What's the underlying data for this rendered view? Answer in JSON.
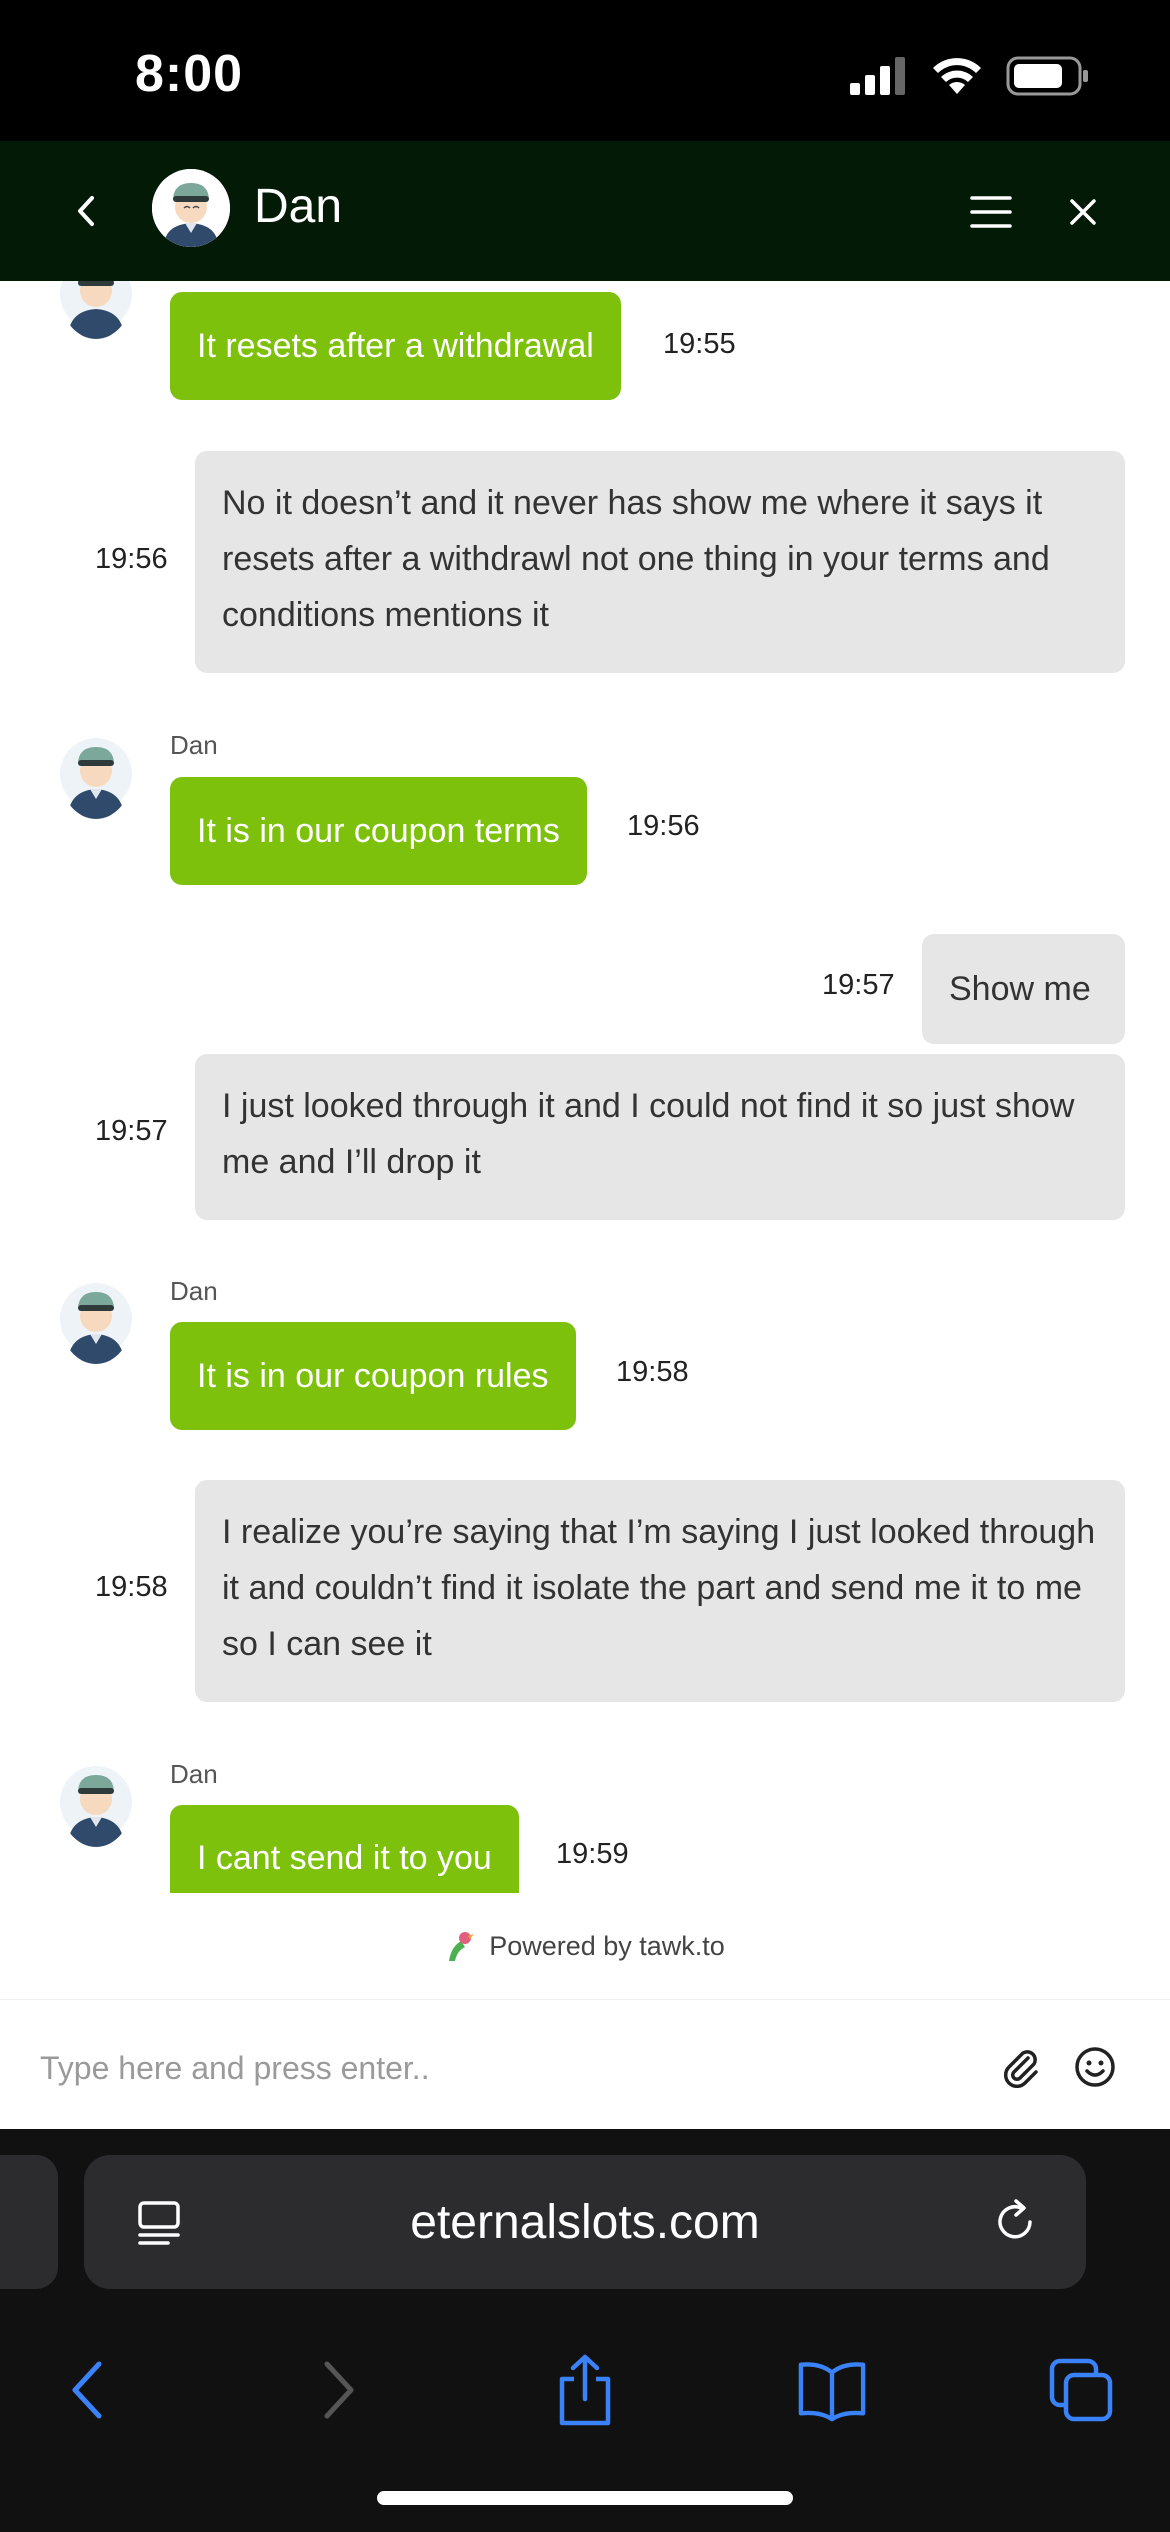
{
  "status_bar": {
    "time": "8:00"
  },
  "header": {
    "agent_name": "Dan"
  },
  "messages": [
    {
      "type": "agent",
      "text": "It resets after a withdrawal",
      "time": "19:55"
    },
    {
      "type": "user",
      "text": "No it doesn’t and it never has show me where it says it resets after a withdrawl not one thing in your terms and conditions mentions it",
      "time": "19:56"
    },
    {
      "type": "agent",
      "sender": "Dan",
      "text": "It is in our coupon terms",
      "time": "19:56"
    },
    {
      "type": "user",
      "text": "Show me",
      "time": "19:57"
    },
    {
      "type": "user",
      "text": "I just looked through it and I could not find it so just show me and I’ll drop it",
      "time": "19:57"
    },
    {
      "type": "agent",
      "sender": "Dan",
      "text": "It is in our coupon rules",
      "time": "19:58"
    },
    {
      "type": "user",
      "text": "I realize you’re saying that I’m saying I just looked through it and couldn’t find it isolate the part and send me it to me so I can see it",
      "time": "19:58"
    },
    {
      "type": "agent",
      "sender": "Dan",
      "text": "I cant send it to you",
      "time": "19:59"
    }
  ],
  "powered_by": "Powered by tawk.to",
  "input": {
    "placeholder": "Type here and press enter.."
  },
  "browser": {
    "url": "eternalslots.com"
  },
  "colors": {
    "header_bg": "#031a07",
    "agent_bubble": "#7dc10c",
    "user_bubble": "#e6e6e6",
    "ios_blue": "#3a82f7"
  }
}
